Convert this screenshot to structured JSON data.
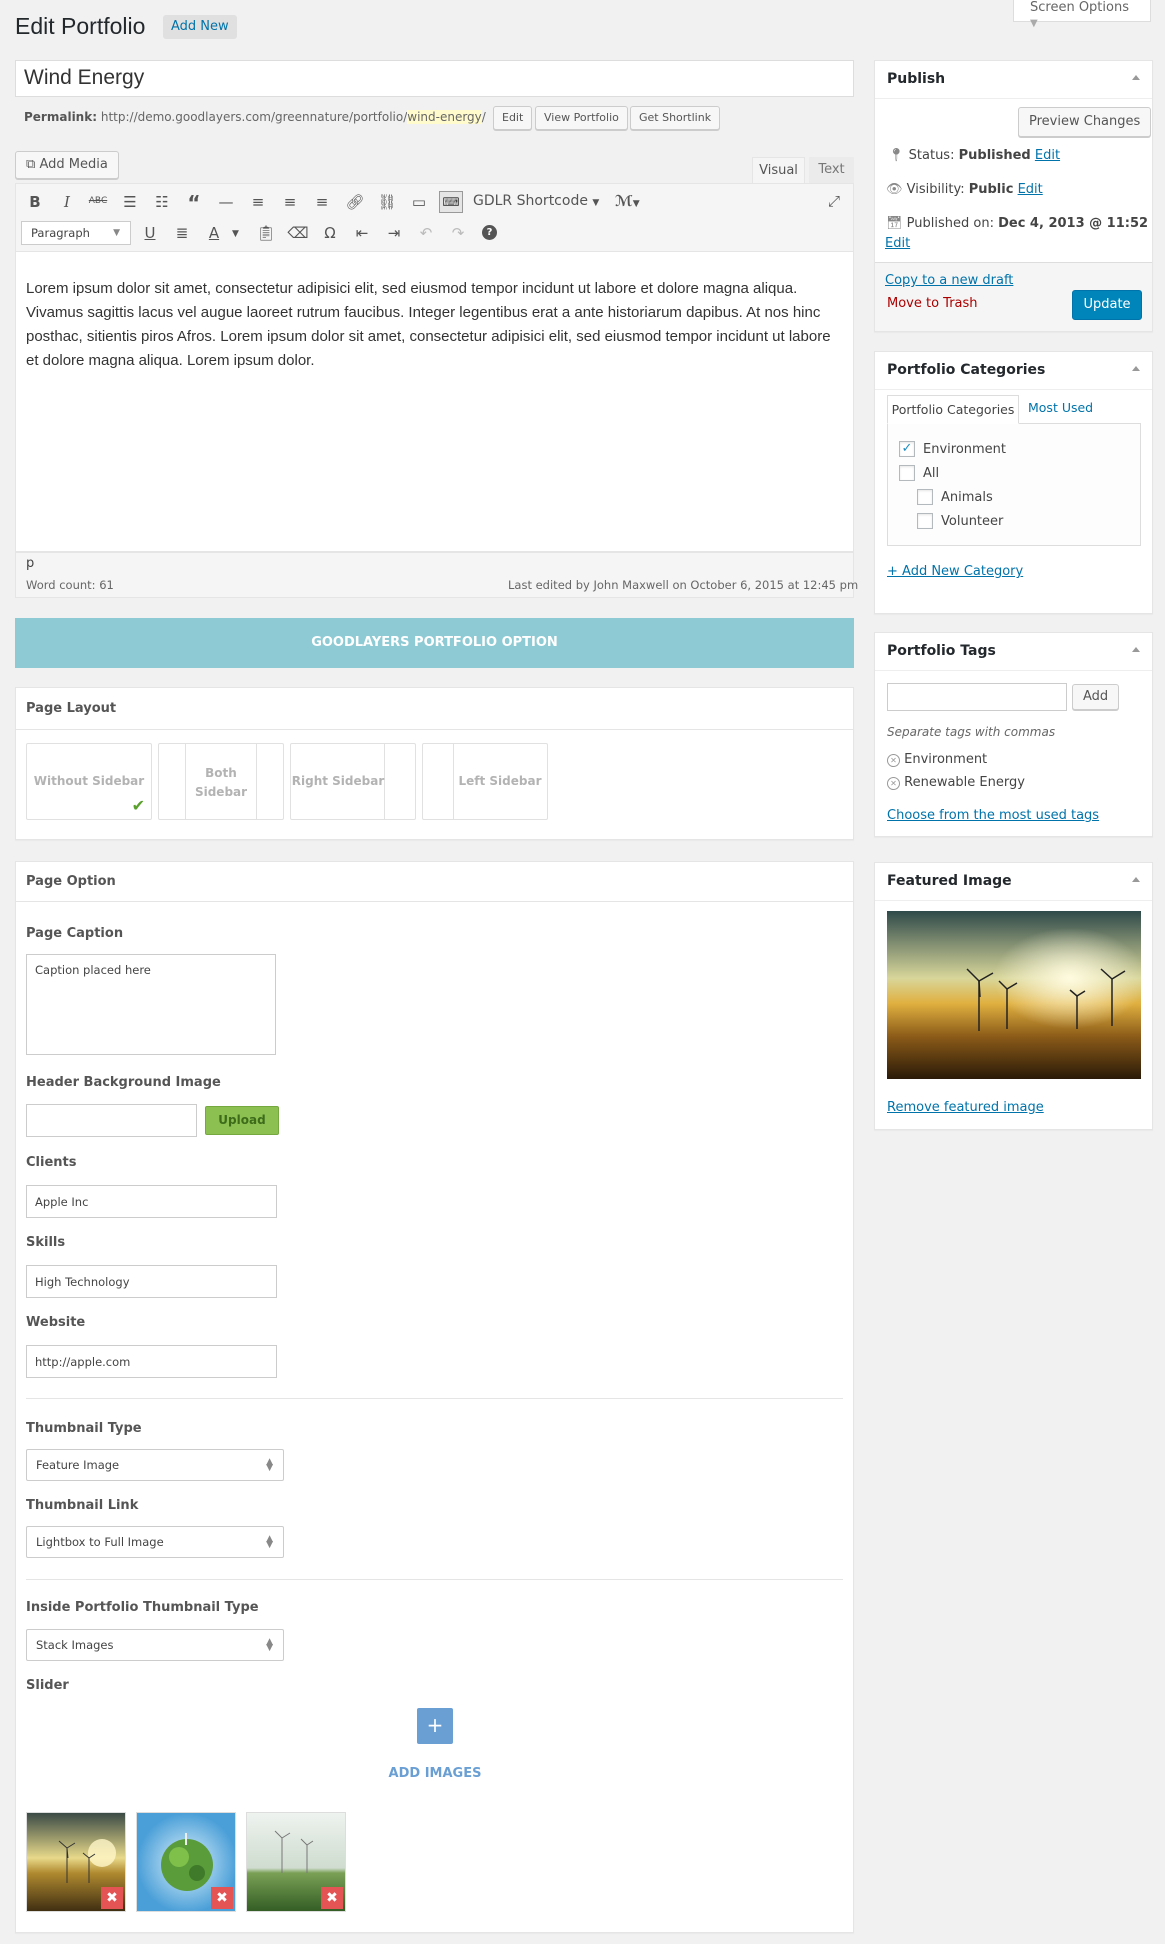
{
  "header": {
    "title": "Edit Portfolio",
    "add_new": "Add New",
    "screen_options": "Screen Options"
  },
  "post": {
    "title": "Wind Energy",
    "permalink_label": "Permalink:",
    "permalink_base": "http://demo.goodlayers.com/greennature/portfolio/",
    "permalink_slug": "wind-energy",
    "permalink_end": "/",
    "btn_edit": "Edit",
    "btn_view": "View Portfolio",
    "btn_shortlink": "Get Shortlink"
  },
  "editor": {
    "add_media": "Add Media",
    "tab_visual": "Visual",
    "tab_text": "Text",
    "shortcode": "GDLR Shortcode",
    "format": "Paragraph",
    "content": "Lorem ipsum dolor sit amet, consectetur adipisici elit, sed eiusmod tempor incidunt ut labore et dolore magna aliqua. Vivamus sagittis lacus vel augue laoreet rutrum faucibus. Integer legentibus erat a ante historiarum dapibus. At nos hinc posthac, sitientis piros Afros. Lorem ipsum dolor sit amet, consectetur adipisici elit, sed eiusmod tempor incidunt ut labore et dolore magna aliqua. Lorem ipsum dolor.",
    "path": "p",
    "word_count": "Word count: 61",
    "last_edited": "Last edited by John Maxwell on October 6, 2015 at 12:45 pm"
  },
  "goodlayers": {
    "banner": "GOODLAYERS PORTFOLIO OPTION",
    "page_layout": "Page Layout",
    "layouts": [
      "Without Sidebar",
      "Both Sidebar",
      "Right Sidebar",
      "Left Sidebar"
    ],
    "page_option": "Page Option",
    "page_caption_label": "Page Caption",
    "page_caption": "Caption placed here",
    "header_bg_label": "Header Background Image",
    "upload": "Upload",
    "clients_label": "Clients",
    "clients": "Apple Inc",
    "skills_label": "Skills",
    "skills": "High Technology",
    "website_label": "Website",
    "website": "http://apple.com",
    "thumb_type_label": "Thumbnail Type",
    "thumb_type": "Feature Image",
    "thumb_link_label": "Thumbnail Link",
    "thumb_link": "Lightbox to Full Image",
    "inside_label": "Inside Portfolio Thumbnail Type",
    "inside": "Stack Images",
    "slider_label": "Slider",
    "add_images": "ADD IMAGES"
  },
  "publish": {
    "title": "Publish",
    "preview": "Preview Changes",
    "status_label": "Status:",
    "status": "Published",
    "visibility_label": "Visibility:",
    "visibility": "Public",
    "published_label": "Published on:",
    "published": "Dec 4, 2013 @ 11:52",
    "edit": "Edit",
    "copy_draft": "Copy to a new draft",
    "trash": "Move to Trash",
    "update": "Update"
  },
  "categories": {
    "title": "Portfolio Categories",
    "tab_all": "Portfolio Categories",
    "tab_used": "Most Used",
    "items": [
      "Environment",
      "All",
      "Animals",
      "Volunteer"
    ],
    "add_new": "+ Add New Category"
  },
  "tags": {
    "title": "Portfolio Tags",
    "add": "Add",
    "hint": "Separate tags with commas",
    "items": [
      "Environment",
      "Renewable Energy"
    ],
    "choose": "Choose from the most used tags"
  },
  "featured": {
    "title": "Featured Image",
    "remove": "Remove featured image"
  },
  "colors": {
    "accent": "#0085ba",
    "banner": "#8ecad4",
    "upload": "#8cc152",
    "add_images": "#5b9bd5",
    "delete": "#e45454"
  }
}
